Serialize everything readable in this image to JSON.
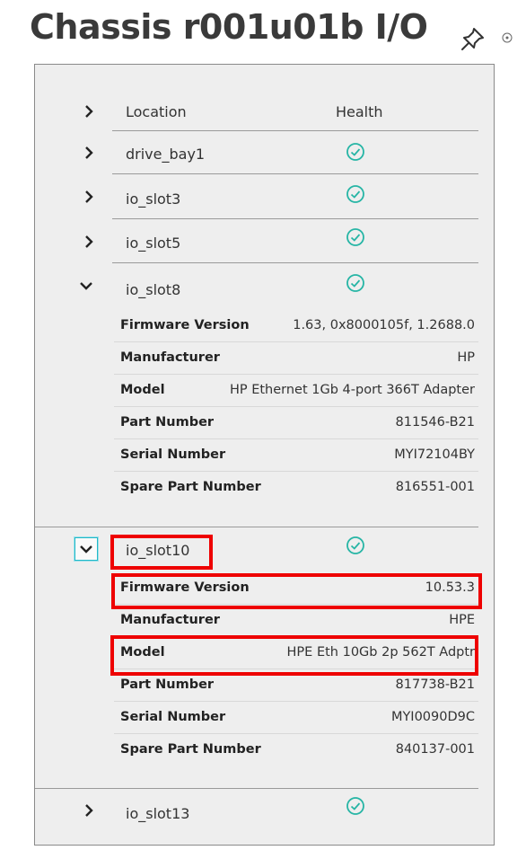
{
  "header": {
    "title": "Chassis r001u01b I/O"
  },
  "table": {
    "col_location": "Location",
    "col_health": "Health",
    "rows": [
      {
        "location": "drive_bay1",
        "health": "ok"
      },
      {
        "location": "io_slot3",
        "health": "ok"
      },
      {
        "location": "io_slot5",
        "health": "ok"
      },
      {
        "location": "io_slot8",
        "health": "ok",
        "details": [
          {
            "label": "Firmware Version",
            "value": "1.63, 0x8000105f, 1.2688.0"
          },
          {
            "label": "Manufacturer",
            "value": "HP"
          },
          {
            "label": "Model",
            "value": "HP Ethernet 1Gb 4-port 366T Adapter"
          },
          {
            "label": "Part Number",
            "value": "811546-B21"
          },
          {
            "label": "Serial Number",
            "value": "MYI72104BY"
          },
          {
            "label": "Spare Part Number",
            "value": "816551-001"
          }
        ]
      },
      {
        "location": "io_slot10",
        "health": "ok",
        "details": [
          {
            "label": "Firmware Version",
            "value": "10.53.3"
          },
          {
            "label": "Manufacturer",
            "value": "HPE"
          },
          {
            "label": "Model",
            "value": "HPE Eth 10Gb 2p 562T Adptr"
          },
          {
            "label": "Part Number",
            "value": "817738-B21"
          },
          {
            "label": "Serial Number",
            "value": "MYI0090D9C"
          },
          {
            "label": "Spare Part Number",
            "value": "840137-001"
          }
        ]
      },
      {
        "location": "io_slot13",
        "health": "ok"
      }
    ]
  },
  "colors": {
    "check": "#26b5a5",
    "highlight": "#ee0000",
    "focus": "#22b8c8"
  }
}
